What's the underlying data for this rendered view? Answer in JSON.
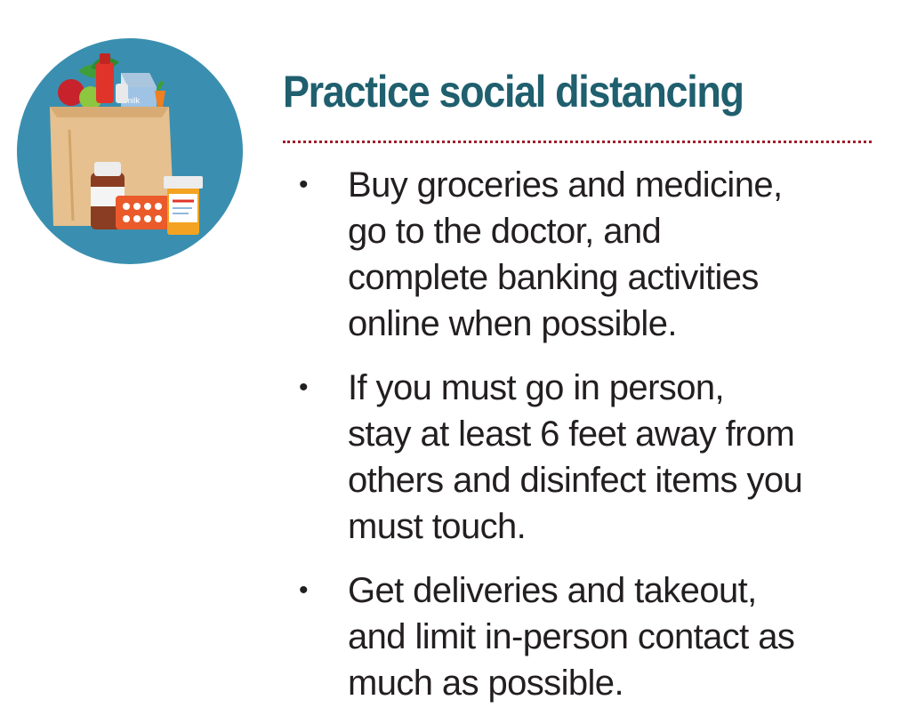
{
  "heading": "Practice social distancing",
  "illustration": {
    "icon": "grocery-bag-medicine-icon",
    "milk_label": "milk"
  },
  "bullets": [
    {
      "marker": "•",
      "text": "Buy groceries and medicine,\ngo to the doctor, and\ncomplete banking activities\nonline when possible."
    },
    {
      "marker": "•",
      "text": "If you must go in person,\nstay at least 6 feet away from\nothers and disinfect items you\nmust touch."
    },
    {
      "marker": "•",
      "text": "Get deliveries and takeout,\nand limit in-person contact as\nmuch as possible."
    }
  ],
  "colors": {
    "heading": "#1f5f6e",
    "divider": "#a01c2a",
    "body_text": "#231f20",
    "circle": "#3a8fb0"
  }
}
